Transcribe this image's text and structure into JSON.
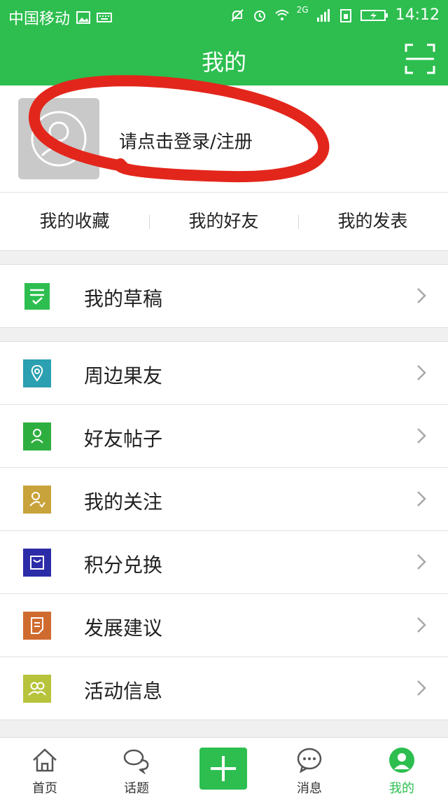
{
  "status_bar": {
    "carrier": "中国移动",
    "network": "2G",
    "time": "14:12"
  },
  "header": {
    "title": "我的"
  },
  "profile": {
    "login_prompt": "请点击登录/注册"
  },
  "quick_tabs": [
    "我的收藏",
    "我的好友",
    "我的发表"
  ],
  "menu": {
    "draft": {
      "label": "我的草稿",
      "icon": "draft-icon",
      "color": "#2dbe4f"
    },
    "items": [
      {
        "label": "周边果友",
        "icon": "location-icon",
        "color": "#2aa0b0"
      },
      {
        "label": "好友帖子",
        "icon": "friend-icon",
        "color": "#2fae40"
      },
      {
        "label": "我的关注",
        "icon": "follow-icon",
        "color": "#c8a23a"
      },
      {
        "label": "积分兑换",
        "icon": "shopping-bag-icon",
        "color": "#2c2ca8"
      },
      {
        "label": "发展建议",
        "icon": "document-icon",
        "color": "#d06b2f"
      },
      {
        "label": "活动信息",
        "icon": "group-icon",
        "color": "#b7c33a"
      }
    ]
  },
  "bottom_nav": {
    "home": "首页",
    "topics": "话题",
    "messages": "消息",
    "mine": "我的"
  },
  "colors": {
    "brand_green": "#2dbe4f",
    "annotation_red": "#e3261b"
  }
}
